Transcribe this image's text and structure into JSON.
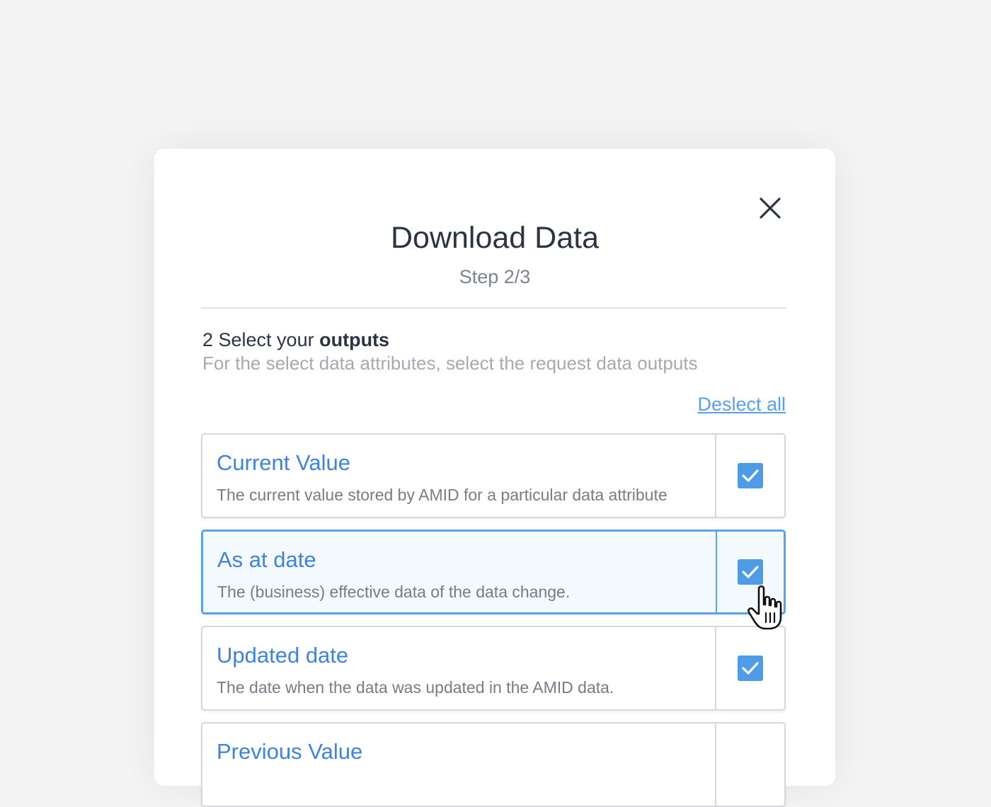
{
  "dialog": {
    "title": "Download Data",
    "step": "Step 2/3"
  },
  "section": {
    "heading_prefix": "2 Select your ",
    "heading_bold": "outputs",
    "description": "For the select data attributes, select the request data outputs"
  },
  "deselect_label": "Deslect all",
  "options": [
    {
      "title": "Current Value",
      "description": "The current value stored by AMID for a particular data attribute",
      "checked": true
    },
    {
      "title": "As at date",
      "description": "The (business) effective data of the data change.",
      "checked": true
    },
    {
      "title": "Updated date",
      "description": "The date when the data was updated in the AMID data.",
      "checked": true
    },
    {
      "title": "Previous Value",
      "description": "",
      "checked": false
    }
  ],
  "colors": {
    "accent": "#4e9ce8",
    "option_title": "#3e83e0",
    "selected_border": "#5aa4ea"
  },
  "icons": {
    "close": "close-icon",
    "check": "checkmark-icon",
    "cursor": "hand-pointer-icon"
  }
}
